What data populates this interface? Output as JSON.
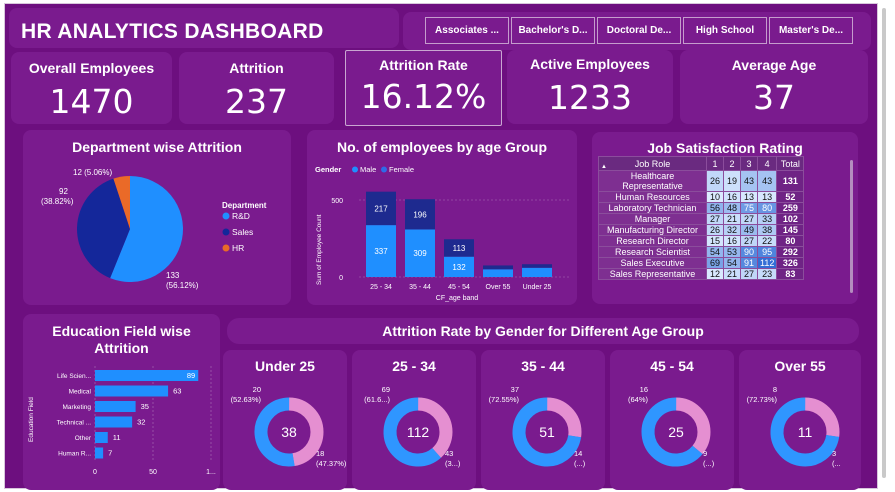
{
  "dashboard": {
    "title": "HR ANALYTICS DASHBOARD",
    "slicers": [
      "Associates ...",
      "Bachelor's D...",
      "Doctoral De...",
      "High School",
      "Master's De..."
    ]
  },
  "kpis": [
    {
      "label": "Overall Employees",
      "value": "1470"
    },
    {
      "label": "Attrition",
      "value": "237"
    },
    {
      "label": "Attrition Rate",
      "value": "16.12%"
    },
    {
      "label": "Active Employees",
      "value": "1233"
    },
    {
      "label": "Average Age",
      "value": "37"
    }
  ],
  "dept_chart": {
    "title": "Department wise Attrition",
    "legend_title": "Department",
    "slice_labels": [
      {
        "line1": "133",
        "line2": "(56.12%)"
      },
      {
        "line1": "92",
        "line2": "(38.82%)"
      },
      {
        "line1": "12 (5.06%)",
        "line2": ""
      }
    ]
  },
  "age_chart": {
    "title": "No. of employees by age Group",
    "legend_title": "Gender",
    "xlabel": "CF_age band",
    "ylabel": "Sum of Employee Count"
  },
  "job_sat": {
    "title": "Job Satisfaction Rating",
    "headers": [
      "Job Role",
      "1",
      "2",
      "3",
      "4",
      "Total"
    ],
    "rows": [
      {
        "role": "Healthcare Representative",
        "r1": 26,
        "r2": 19,
        "r3": 43,
        "r4": 43,
        "total": 131
      },
      {
        "role": "Human Resources",
        "r1": 10,
        "r2": 16,
        "r3": 13,
        "r4": 13,
        "total": 52
      },
      {
        "role": "Laboratory Technician",
        "r1": 56,
        "r2": 48,
        "r3": 75,
        "r4": 80,
        "total": 259
      },
      {
        "role": "Manager",
        "r1": 27,
        "r2": 21,
        "r3": 27,
        "r4": 33,
        "total": 102
      },
      {
        "role": "Manufacturing Director",
        "r1": 26,
        "r2": 32,
        "r3": 49,
        "r4": 38,
        "total": 145
      },
      {
        "role": "Research Director",
        "r1": 15,
        "r2": 16,
        "r3": 27,
        "r4": 22,
        "total": 80
      },
      {
        "role": "Research Scientist",
        "r1": 54,
        "r2": 53,
        "r3": 90,
        "r4": 95,
        "total": 292
      },
      {
        "role": "Sales Executive",
        "r1": 69,
        "r2": 54,
        "r3": 91,
        "r4": 112,
        "total": 326
      },
      {
        "role": "Sales Representative",
        "r1": 12,
        "r2": 21,
        "r3": 27,
        "r4": 23,
        "total": 83
      }
    ]
  },
  "edu_chart": {
    "title_line1": "Education Field wise",
    "title_line2": "Attrition",
    "ylabel": "Education Field"
  },
  "gender_section": {
    "title": "Attrition Rate by Gender for Different Age Group"
  },
  "colors": {
    "background": "#6d0f7f",
    "panel": "#7a1b8e",
    "male": "#2f96ff",
    "female": "#e58fd1",
    "rnd": "#1f8fff",
    "sales": "#14279a",
    "hr": "#ea6a28",
    "bar_dark": "#1e2a8f",
    "bar_light": "#1f8fff"
  },
  "chart_data": [
    {
      "type": "pie",
      "title": "Department wise Attrition",
      "legend_title": "Department",
      "categories": [
        "R&D",
        "Sales",
        "HR"
      ],
      "values": [
        133,
        92,
        12
      ],
      "percent_labels": [
        "(56.12%)",
        "(38.82%)",
        "(5.06%)"
      ],
      "legend": "right"
    },
    {
      "type": "bar",
      "title": "No. of employees by age Group",
      "stacked": true,
      "categories": [
        "25 - 34",
        "35 - 44",
        "45 - 54",
        "Over 55",
        "Under 25"
      ],
      "series": [
        {
          "name": "Male",
          "values": [
            337,
            309,
            132,
            50,
            60
          ]
        },
        {
          "name": "Female",
          "values": [
            217,
            196,
            113,
            25,
            23
          ]
        }
      ],
      "labels": {
        "Male": [
          "337",
          "309",
          "132",
          "",
          ""
        ],
        "Female": [
          "217",
          "196",
          "113",
          "",
          ""
        ]
      },
      "yticks": [
        "0",
        "500"
      ],
      "ylim": [
        0,
        600
      ],
      "xlabel": "CF_age band",
      "ylabel": "Sum of Employee Count",
      "legend": "top-left"
    },
    {
      "type": "bar",
      "orientation": "horizontal",
      "title": "Education Field wise Attrition",
      "categories": [
        "Life Scien...",
        "Medical",
        "Marketing",
        "Technical ...",
        "Other",
        "Human R..."
      ],
      "values": [
        89,
        63,
        35,
        32,
        11,
        7
      ],
      "xticks": [
        "0",
        "50",
        "1..."
      ],
      "xlim": [
        0,
        100
      ],
      "ylabel": "Education Field"
    },
    {
      "type": "pie",
      "variant": "donut",
      "title": "Attrition Rate by Gender for Different Age Group",
      "donuts": [
        {
          "group": "Under 25",
          "total": "38",
          "male": 20,
          "female": 18,
          "male_label": [
            "20",
            "(52.63%)"
          ],
          "female_label": [
            "18",
            "(47.37%)"
          ]
        },
        {
          "group": "25 - 34",
          "total": "112",
          "male": 69,
          "female": 43,
          "male_label": [
            "69",
            "(61.6...)"
          ],
          "female_label": [
            "43",
            "(3...)"
          ]
        },
        {
          "group": "35 - 44",
          "total": "51",
          "male": 37,
          "female": 14,
          "male_label": [
            "37",
            "(72.55%)"
          ],
          "female_label": [
            "14",
            "(...)"
          ]
        },
        {
          "group": "45 - 54",
          "total": "25",
          "male": 16,
          "female": 9,
          "male_label": [
            "16",
            "(64%)"
          ],
          "female_label": [
            "9",
            "(...)"
          ]
        },
        {
          "group": "Over 55",
          "total": "11",
          "male": 8,
          "female": 3,
          "male_label": [
            "8",
            "(72.73%)"
          ],
          "female_label": [
            "3",
            "(..."
          ]
        }
      ]
    }
  ]
}
